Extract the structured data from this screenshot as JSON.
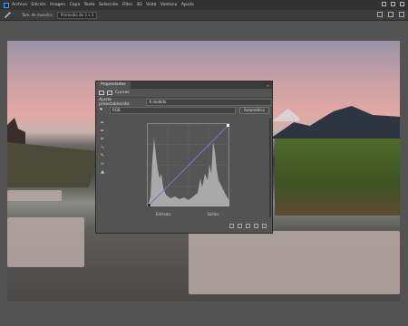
{
  "menubar": {
    "items": [
      "Archivo",
      "Edición",
      "Imagen",
      "Capa",
      "Texto",
      "Selección",
      "Filtro",
      "3D",
      "Vista",
      "Ventana",
      "Ayuda"
    ]
  },
  "options_bar": {
    "sample_label": "Tam. de muestra:",
    "sample_value": "Promedio de 3 x 3"
  },
  "panel": {
    "title": "Propiedades",
    "layer_type": "Curvas",
    "preset_label": "Ajuste preestablecido:",
    "preset_value": "A medida",
    "channel_value": "RGB",
    "auto_button": "Automático",
    "input_label": "Entrada:",
    "output_label": "Salida:"
  },
  "colors": {
    "accent": "#31a8ff",
    "curve_line": "#4a86e0",
    "red_line": "#d9534f"
  }
}
